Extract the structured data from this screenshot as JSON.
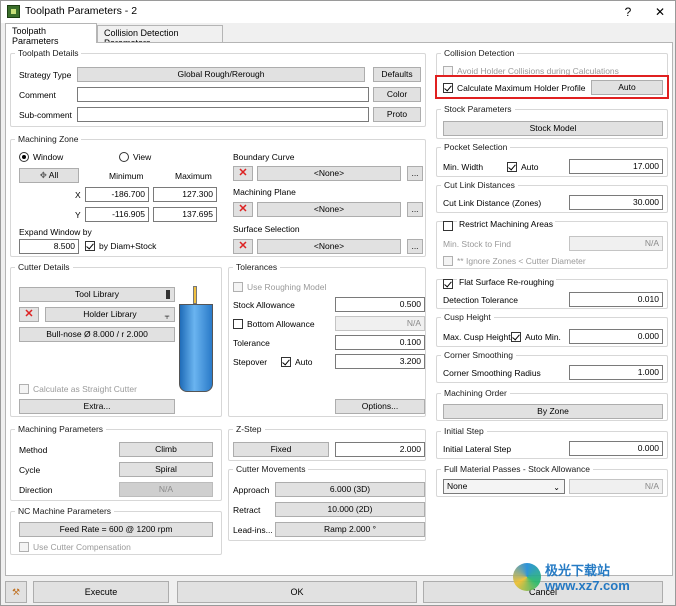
{
  "window": {
    "title": "Toolpath Parameters - 2",
    "help": "?",
    "close": "✕"
  },
  "tabs": [
    {
      "label": "Toolpath Parameters"
    },
    {
      "label": "Collision Detection Parameters"
    }
  ],
  "toolpath_details": {
    "title": "Toolpath Details",
    "strategy_label": "Strategy Type",
    "strategy_value": "Global Rough/Rerough",
    "defaults_btn": "Defaults",
    "comment_label": "Comment",
    "comment_value": "",
    "color_btn": "Color",
    "subcomment_label": "Sub-comment",
    "subcomment_value": "",
    "proto_btn": "Proto"
  },
  "machining_zone": {
    "title": "Machining Zone",
    "window_label": "Window",
    "view_label": "View",
    "all_btn": "All",
    "minimum_label": "Minimum",
    "maximum_label": "Maximum",
    "x_label": "X",
    "x_min": "-186.700",
    "x_max": "127.300",
    "y_label": "Y",
    "y_min": "-116.905",
    "y_max": "137.695",
    "expand_label": "Expand Window by",
    "expand_value": "8.500",
    "by_diam_label": "by Diam+Stock",
    "boundary_label": "Boundary Curve",
    "boundary_value": "<None>",
    "plane_label": "Machining Plane",
    "plane_value": "<None>",
    "surface_label": "Surface Selection",
    "surface_value": "<None>",
    "ellipsis": "..."
  },
  "cutter_details": {
    "title": "Cutter Details",
    "tool_library_btn": "Tool Library",
    "holder_library_btn": "Holder Library",
    "tool_desc": "Bull-nose Ø 8.000 / r 2.000",
    "straight_cutter_label": "Calculate as Straight Cutter",
    "extra_btn": "Extra..."
  },
  "tolerances": {
    "title": "Tolerances",
    "use_roughing_label": "Use Roughing Model",
    "stock_allowance_label": "Stock Allowance",
    "stock_allowance_value": "0.500",
    "bottom_allowance_label": "Bottom Allowance",
    "bottom_allowance_value": "N/A",
    "tolerance_label": "Tolerance",
    "tolerance_value": "0.100",
    "stepover_label": "Stepover",
    "stepover_auto_label": "Auto",
    "stepover_value": "3.200",
    "options_btn": "Options..."
  },
  "machining_parameters": {
    "title": "Machining Parameters",
    "method_label": "Method",
    "method_value": "Climb",
    "cycle_label": "Cycle",
    "cycle_value": "Spiral",
    "direction_label": "Direction",
    "direction_value": "N/A"
  },
  "nc_parameters": {
    "title": "NC Machine Parameters",
    "feed_rate": "Feed Rate = 600 @ 1200 rpm",
    "cutter_comp_label": "Use Cutter Compensation"
  },
  "z_step": {
    "title": "Z-Step",
    "type_value": "Fixed",
    "value": "2.000"
  },
  "cutter_movements": {
    "title": "Cutter Movements",
    "approach_label": "Approach",
    "approach_value": "6.000 (3D)",
    "retract_label": "Retract",
    "retract_value": "10.000 (2D)",
    "leadins_label": "Lead-ins...",
    "leadins_value": "Ramp 2.000 °"
  },
  "collision_detection": {
    "title": "Collision Detection",
    "avoid_holder_label": "Avoid Holder Collisions during Calculations",
    "calc_max_holder_label": "Calculate Maximum Holder Profile",
    "auto_btn": "Auto"
  },
  "stock_parameters": {
    "title": "Stock Parameters",
    "stock_model_btn": "Stock Model"
  },
  "pocket_selection": {
    "title": "Pocket Selection",
    "min_width_label": "Min. Width",
    "auto_label": "Auto",
    "min_width_value": "17.000"
  },
  "cut_link": {
    "title": "Cut Link Distances",
    "label": "Cut Link Distance (Zones)",
    "value": "30.000"
  },
  "restrict_areas": {
    "label": "Restrict Machining Areas",
    "min_stock_label": "Min. Stock to Find",
    "min_stock_value": "N/A",
    "ignore_zones_label": "** Ignore Zones < Cutter Diameter"
  },
  "flat_surface": {
    "label": "Flat Surface Re-roughing",
    "detection_label": "Detection Tolerance",
    "detection_value": "0.010"
  },
  "cusp_height": {
    "title": "Cusp Height",
    "label": "Max. Cusp Height",
    "auto_min_label": "Auto Min.",
    "value": "0.000"
  },
  "corner_smoothing": {
    "title": "Corner Smoothing",
    "label": "Corner Smoothing Radius",
    "value": "1.000"
  },
  "machining_order": {
    "title": "Machining Order",
    "value": "By Zone"
  },
  "initial_step": {
    "title": "Initial Step",
    "label": "Initial Lateral Step",
    "value": "0.000"
  },
  "full_material": {
    "title": "Full Material Passes - Stock Allowance",
    "select_value": "None",
    "value": "N/A"
  },
  "footer": {
    "execute_btn": "Execute",
    "ok_btn": "OK",
    "cancel_btn": "Cancel"
  },
  "watermark": "极光下载站 www.xz7.com",
  "colors": {
    "highlight": "#e02020",
    "tool_blue": "#3b8fd9",
    "tool_holder": "#f0c040"
  }
}
